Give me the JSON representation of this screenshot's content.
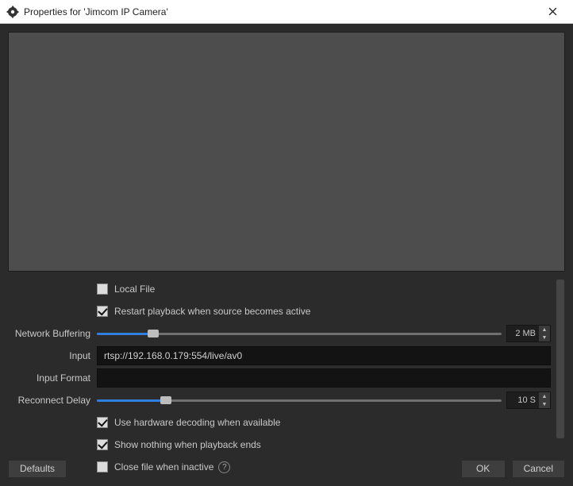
{
  "window": {
    "title": "Properties for 'Jimcom IP Camera'"
  },
  "fields": {
    "localFile": {
      "label": "Local File",
      "checked": false
    },
    "restartPlayback": {
      "label": "Restart playback when source becomes active",
      "checked": true
    },
    "networkBuffering": {
      "label": "Network Buffering",
      "value": "2 MB",
      "position_pct": 14
    },
    "input": {
      "label": "Input",
      "value": "rtsp://192.168.0.179:554/live/av0"
    },
    "inputFormat": {
      "label": "Input Format",
      "value": ""
    },
    "reconnectDelay": {
      "label": "Reconnect Delay",
      "value": "10 S",
      "position_pct": 17
    },
    "hwDecoding": {
      "label": "Use hardware decoding when available",
      "checked": true
    },
    "showNothing": {
      "label": "Show nothing when playback ends",
      "checked": true
    },
    "closeInactive": {
      "label": "Close file when inactive",
      "checked": false
    }
  },
  "buttons": {
    "defaults": "Defaults",
    "ok": "OK",
    "cancel": "Cancel"
  }
}
